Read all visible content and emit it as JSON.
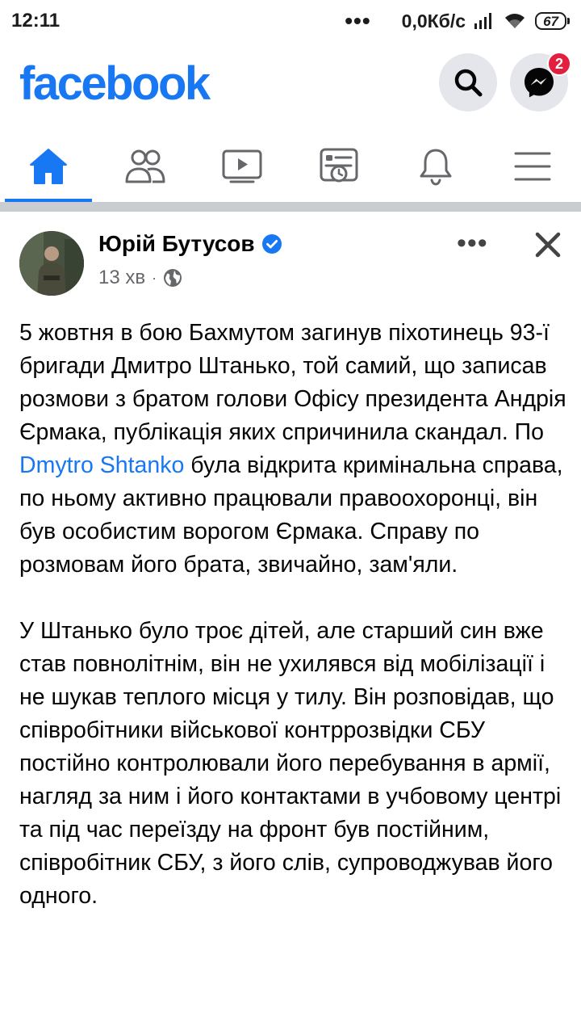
{
  "status_bar": {
    "time": "12:11",
    "network_speed": "0,0Кб/с",
    "battery": "67"
  },
  "header": {
    "logo": "facebook",
    "messenger_badge": "2",
    "brand_color": "#1877f2"
  },
  "tabs": [
    {
      "icon": "home-icon",
      "active": true
    },
    {
      "icon": "friends-icon",
      "active": false
    },
    {
      "icon": "video-icon",
      "active": false
    },
    {
      "icon": "news-icon",
      "active": false
    },
    {
      "icon": "bell-icon",
      "active": false
    },
    {
      "icon": "menu-icon",
      "active": false
    }
  ],
  "post": {
    "author": "Юрій Бутусов",
    "time": "13 хв",
    "paragraph1_before": "5 жовтня в бою Бахмутом загинув піхотинець 93-ї бригади Дмитро Штанько, той самий, що записав розмови з братом голови Офісу президента Андрія Єрмака, публікація яких спричинила скандал. По ",
    "mention": "Dmytro Shtanko",
    "paragraph1_after": " була відкрита кримінальна справа, по ньому активно працювали правоохоронці, він був особистим ворогом Єрмака. Справу по розмовам його брата, звичайно, зам'яли.",
    "paragraph2": "У Штанько було троє дітей, але старший син вже став повнолітнім, він не ухилявся від мобілізації і не шукав теплого місця у тилу. Він розповідав, що співробітники військової контррозвідки СБУ постійно контролювали його перебування в армії, нагляд за ним і його контактами в учбовому центрі та під час переїзду на фронт був постійним, співробітник СБУ, з його слів, супроводжував його одного."
  }
}
